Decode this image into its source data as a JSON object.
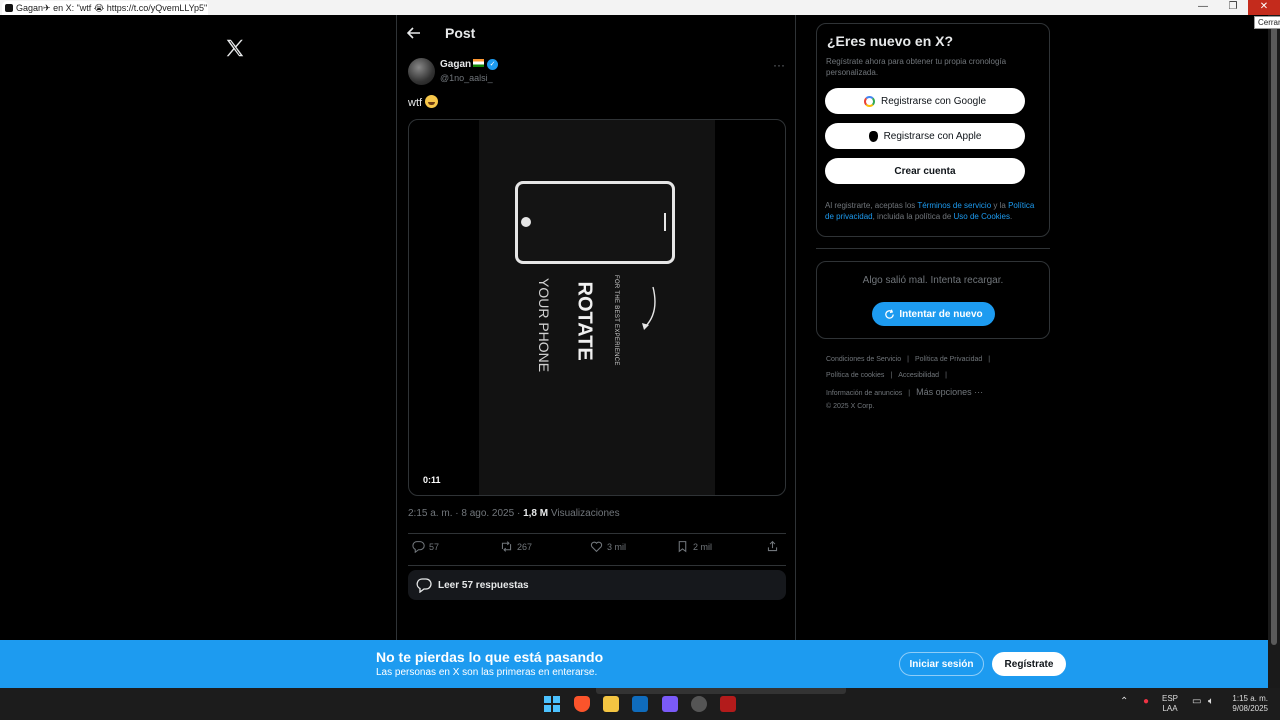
{
  "window": {
    "tab_title": "Gagan✈ en X: \"wtf 😭 https://t.co/yQvemLLYp5\" / X",
    "minimize": "—",
    "maximize": "❐",
    "close": "✕",
    "close_tooltip": "Cerrar"
  },
  "header": {
    "title": "Post"
  },
  "post": {
    "author_name": "Gagan",
    "author_handle": "@1no_aalsi_",
    "text": "wtf",
    "video": {
      "line_small": "FOR THE BEST EXPERIENCE",
      "line_big": "ROTATE",
      "line_medium": "YOUR PHONE",
      "duration": "0:11"
    },
    "time": "2:15 a. m. · 8 ago. 2025 · ",
    "views_count": "1,8 M",
    "views_label": " Visualizaciones",
    "replies": "57",
    "reposts": "267",
    "likes": "3 mil",
    "bookmarks": "2 mil",
    "read_replies": "Leer 57 respuestas"
  },
  "sidebar": {
    "signup_title": "¿Eres nuevo en X?",
    "signup_sub": "Regístrate ahora para obtener tu propia cronología personalizada.",
    "google_btn": "Registrarse con Google",
    "apple_btn": "Registrarse con Apple",
    "create_btn": "Crear cuenta",
    "legal_1": "Al registrarte, aceptas los ",
    "legal_terms": "Términos de servicio",
    "legal_2": " y la ",
    "legal_privacy": "Política de privacidad",
    "legal_3": ", incluida la política de ",
    "legal_cookies": "Uso de Cookies",
    "legal_4": ".",
    "error_text": "Algo salió mal. Intenta recargar.",
    "retry_btn": "Intentar de nuevo",
    "footer": {
      "terms": "Condiciones de Servicio",
      "privacy": "Política de Privacidad",
      "cookies": "Política de cookies",
      "accessibility": "Accesibilidad",
      "ads": "Información de anuncios",
      "more": "Más opciones ···",
      "copyright": "© 2025 X Corp."
    }
  },
  "banner": {
    "title": "No te pierdas lo que está pasando",
    "sub": "Las personas en X son las primeras en enterarse.",
    "login": "Iniciar sesión",
    "register": "Regístrate"
  },
  "taskbar": {
    "lang_1": "ESP",
    "lang_2": "LAA",
    "time": "1:15 a. m.",
    "date": "9/08/2025"
  },
  "colors": {
    "accent": "#1d9bf0",
    "background": "#000000",
    "muted": "#71767b"
  }
}
